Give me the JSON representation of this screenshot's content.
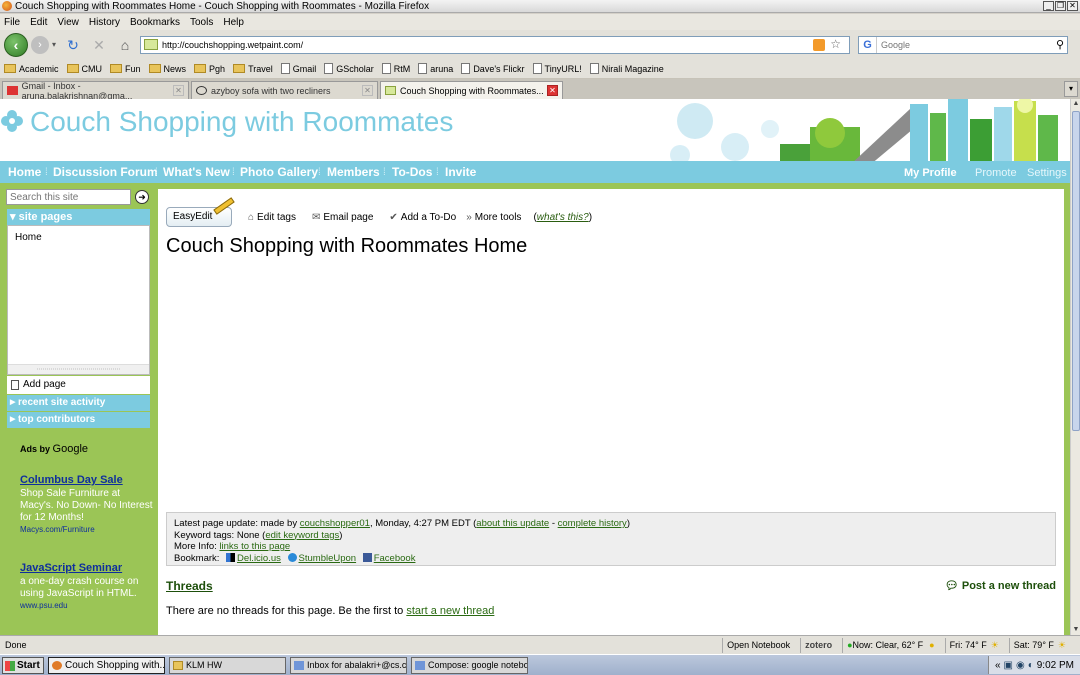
{
  "window": {
    "title": "Couch Shopping with Roommates Home - Couch Shopping with Roommates - Mozilla Firefox"
  },
  "menu": [
    "File",
    "Edit",
    "View",
    "History",
    "Bookmarks",
    "Tools",
    "Help"
  ],
  "nav": {
    "url": "http://couchshopping.wetpaint.com/",
    "search_placeholder": "Google"
  },
  "bookmarks": [
    "Academic",
    "CMU",
    "Fun",
    "News",
    "Pgh",
    "Travel",
    "Gmail",
    "GScholar",
    "RtM",
    "aruna",
    "Dave's Flickr",
    "TinyURL!",
    "Nirali Magazine"
  ],
  "tabs": [
    "Gmail - Inbox - aruna.balakrishnan@gma...",
    "azyboy sofa with two recliners",
    "Couch Shopping with Roommates..."
  ],
  "site": {
    "title": "Couch Shopping with Roommates",
    "nav": [
      "Home",
      "Discussion Forum",
      "What's New",
      "Photo Gallery",
      "Members",
      "To-Dos",
      "Invite"
    ],
    "nav_right": [
      "My Profile",
      "Promote",
      "Settings"
    ]
  },
  "sidebar": {
    "search_placeholder": "Search this site",
    "site_pages": "site pages",
    "home": "Home",
    "add_page": "Add page",
    "recent_activity": "recent site activity",
    "top_contributors": "top contributors"
  },
  "ads": {
    "label": "Ads by",
    "label_brand": "Google",
    "items": [
      {
        "title": "Columbus Day Sale",
        "text": "Shop Sale Furniture at Macy's. No Down- No Interest for 12 Months!",
        "url": "Macys.com/Furniture"
      },
      {
        "title": "JavaScript Seminar",
        "text": "a one-day crash course on using JavaScript in HTML.",
        "url": "www.psu.edu"
      }
    ]
  },
  "main": {
    "easyedit": "EasyEdit",
    "tools": [
      "Edit tags",
      "Email page",
      "Add a To-Do",
      "More tools"
    ],
    "whats_this": "what's this?",
    "page_title": "Couch Shopping with Roommates Home",
    "update": {
      "prefix": "Latest page update: made by",
      "user": "couchshopper01",
      "when": ", Monday, 4:27 PM EDT (",
      "about": "about this update",
      "dash": " - ",
      "history": "complete history",
      "close": ")",
      "keywords_prefix": "Keyword tags: None (",
      "keywords_link": "edit keyword tags",
      "more_info": "More Info:",
      "links": "links to this page",
      "bookmark": "Bookmark:",
      "delicious": "Del.icio.us",
      "stumble": "StumbleUpon",
      "facebook": "Facebook"
    },
    "threads": "Threads",
    "post_thread": "Post a new thread",
    "no_threads": "There are no threads for this page. Be the first to",
    "start_thread": "start a new thread"
  },
  "status": {
    "left": "Done",
    "notebook": "Open Notebook",
    "zotero": "zotero",
    "now": "Now: Clear, 62° F",
    "fri": "Fri: 74° F",
    "sat": "Sat: 79° F"
  },
  "taskbar": {
    "start": "Start",
    "tasks": [
      "Couch Shopping with...",
      "KLM HW",
      "Inbox for abalakri+@cs.c...",
      "Compose: google notebo..."
    ],
    "time": "9:02 PM"
  }
}
